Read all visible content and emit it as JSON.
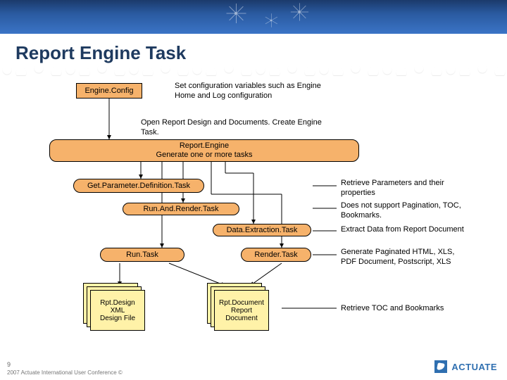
{
  "slide": {
    "title": "Report Engine Task",
    "boxes": {
      "engine_config": "Engine.Config",
      "report_engine_line1": "Report.Engine",
      "report_engine_line2": "Generate one or more tasks",
      "get_param_task": "Get.Parameter.Definition.Task",
      "run_and_render": "Run.And.Render.Task",
      "data_extraction": "Data.Extraction.Task",
      "run_task": "Run.Task",
      "render_task": "Render.Task"
    },
    "stacks": {
      "design_line1": "Rpt.Design",
      "design_line2": "XML",
      "design_line3": "Design File",
      "doc_line1": "Rpt.Document",
      "doc_line2": "Report",
      "doc_line3": "Document"
    },
    "notes": {
      "engine_config_note": "Set configuration variables such as Engine Home and Log configuration",
      "open_design_note": "Open Report Design and Documents. Create Engine Task.",
      "get_param_note": "Retrieve Parameters and their properties",
      "run_and_render_note": "Does not support Pagination, TOC, Bookmarks.",
      "data_extraction_note": "Extract Data from Report Document",
      "render_note": "Generate Paginated HTML, XLS, PDF Document, Postscript, XLS",
      "toc_note": "Retrieve TOC and Bookmarks"
    },
    "footer": {
      "page": "9",
      "copyright": "2007 Actuate International User Conference ©"
    },
    "brand": "ACTUATE"
  }
}
